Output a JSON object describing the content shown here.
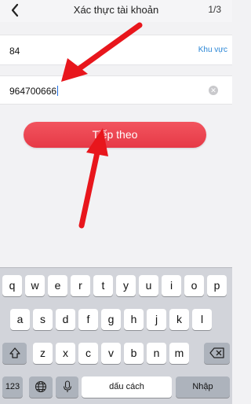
{
  "header": {
    "title": "Xác thực tài khoản",
    "step": "1/3"
  },
  "country": {
    "code": "84",
    "region_label": "Khu vực"
  },
  "phone": {
    "value": "964700666"
  },
  "next_button": {
    "label": "Tiếp theo"
  },
  "keyboard": {
    "row1": [
      "q",
      "w",
      "e",
      "r",
      "t",
      "y",
      "u",
      "i",
      "o",
      "p"
    ],
    "row2": [
      "a",
      "s",
      "d",
      "f",
      "g",
      "h",
      "j",
      "k",
      "l"
    ],
    "row3": [
      "z",
      "x",
      "c",
      "v",
      "b",
      "n",
      "m"
    ],
    "numbers_label": "123",
    "space_label": "dấu cách",
    "return_label": "Nhập"
  },
  "colors": {
    "accent": "#e63946",
    "arrow": "#e8161c",
    "link": "#2a86d6"
  }
}
